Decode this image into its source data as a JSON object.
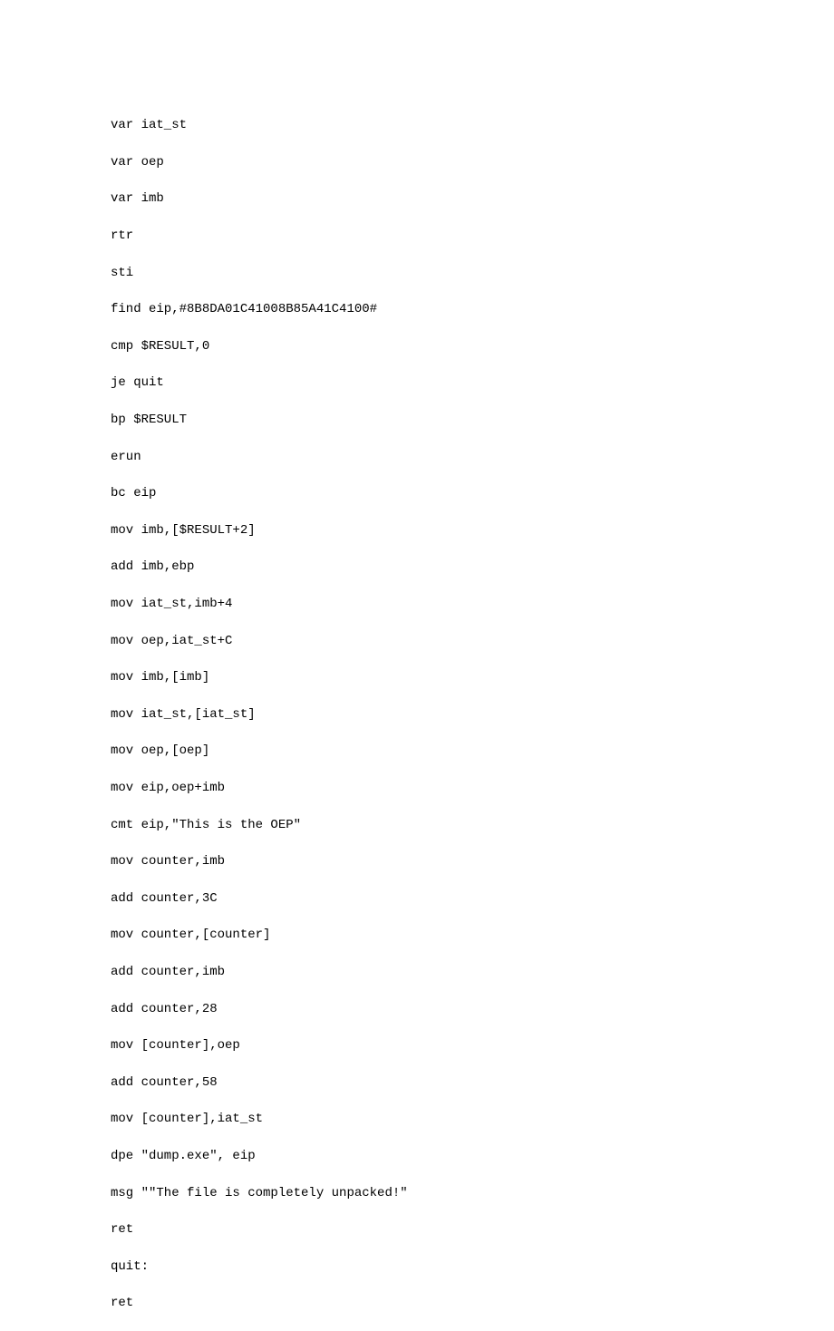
{
  "code_lines": [
    "var iat_st",
    "var oep",
    "var imb",
    "rtr",
    "sti",
    "find eip,#8B8DA01C41008B85A41C4100#",
    "cmp $RESULT,0",
    "je quit",
    "bp $RESULT",
    "erun",
    "bc eip",
    "mov imb,[$RESULT+2]",
    "add imb,ebp",
    "mov iat_st,imb+4",
    "mov oep,iat_st+C",
    "mov imb,[imb]",
    "mov iat_st,[iat_st]",
    "mov oep,[oep]",
    "mov eip,oep+imb",
    "cmt eip,\"This is the OEP\"",
    "mov counter,imb",
    "add counter,3C",
    "mov counter,[counter]",
    "add counter,imb",
    "add counter,28",
    "mov [counter],oep",
    "add counter,58",
    "mov [counter],iat_st",
    "dpe \"dump.exe\", eip",
    "msg \"\"The file is completely unpacked!\"",
    "ret",
    "quit:",
    "ret"
  ]
}
